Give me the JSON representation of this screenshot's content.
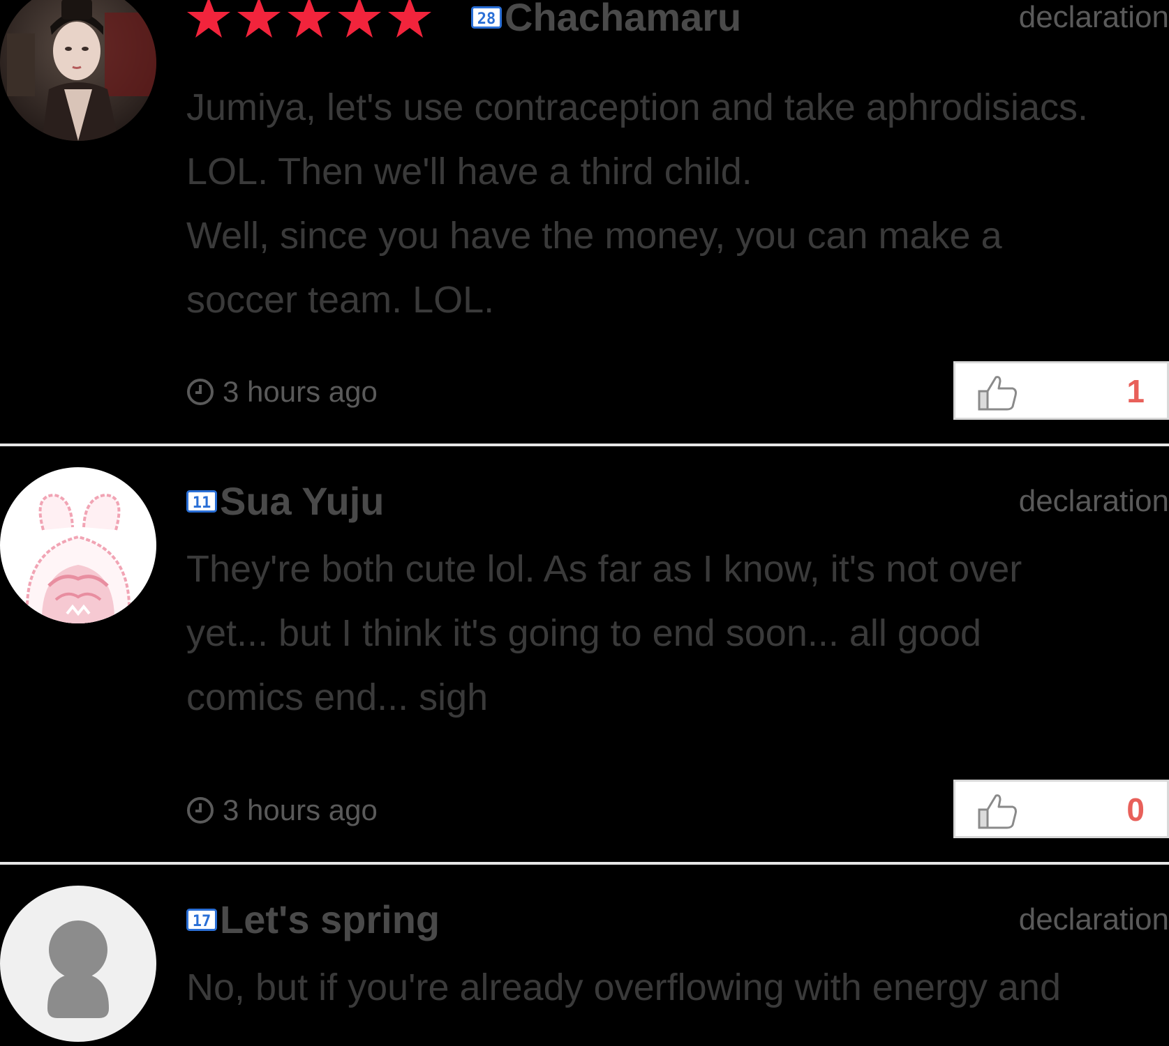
{
  "comments": [
    {
      "username": "Chachamaru",
      "level": "28",
      "rating": 5,
      "declaration_label": "declaration",
      "text_lines": [
        "Jumiya, let's use contraception and take aphrodisiacs.",
        "LOL. Then we'll have a third child.",
        "Well, since you have the money, you can make a",
        "soccer team. LOL."
      ],
      "time": "3 hours ago",
      "likes": "1"
    },
    {
      "username": "Sua Yuju",
      "level": "11",
      "declaration_label": "declaration",
      "text_lines": [
        "They're both cute lol. As far as I know, it's not over",
        "yet... but I think it's going to end soon... all good",
        "comics end... sigh"
      ],
      "time": "3 hours ago",
      "likes": "0"
    },
    {
      "username": "Let's spring",
      "level": "17",
      "declaration_label": "declaration",
      "text_lines": [
        "No, but if you're already overflowing with energy and"
      ]
    }
  ],
  "colors": {
    "star": "#f2243c",
    "like_count": "#e8605a",
    "badge_blue": "#2a6fd6",
    "background": "#000000"
  },
  "icons": {
    "star": "star-icon",
    "level_badge": "level-badge-icon",
    "clock": "clock-icon",
    "thumbs_up": "thumbs-up-icon",
    "default_avatar": "user-silhouette-icon"
  }
}
